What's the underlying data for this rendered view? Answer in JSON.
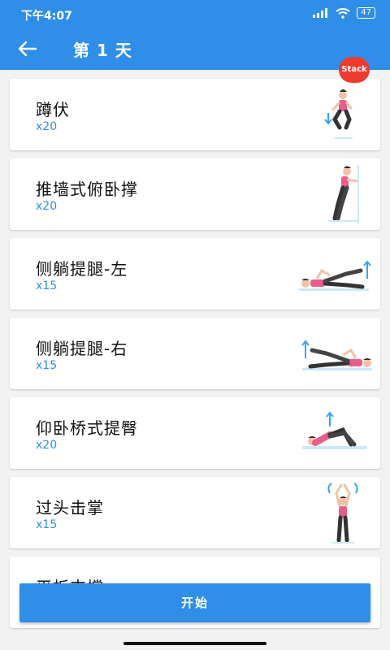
{
  "status_bar": {
    "time": "下午4:07",
    "battery": "47"
  },
  "header": {
    "title": "第 1 天"
  },
  "exercises": [
    {
      "name": "蹲伏",
      "reps": "x20",
      "image": "squat-figure"
    },
    {
      "name": "推墙式俯卧撑",
      "reps": "x20",
      "image": "wall-pushup-figure"
    },
    {
      "name": "侧躺提腿-左",
      "reps": "x15",
      "image": "side-leg-raise-left-figure"
    },
    {
      "name": "侧躺提腿-右",
      "reps": "x15",
      "image": "side-leg-raise-right-figure"
    },
    {
      "name": "仰卧桥式提臀",
      "reps": "x20",
      "image": "glute-bridge-figure"
    },
    {
      "name": "过头击掌",
      "reps": "x15",
      "image": "overhead-clap-figure"
    },
    {
      "name": "平板支撑",
      "reps": "",
      "image": ""
    }
  ],
  "badge": {
    "label": "Stack"
  },
  "footer": {
    "start_label": "开始"
  },
  "colors": {
    "primary": "#2e8ee8",
    "badge": "#ee3b2f"
  }
}
